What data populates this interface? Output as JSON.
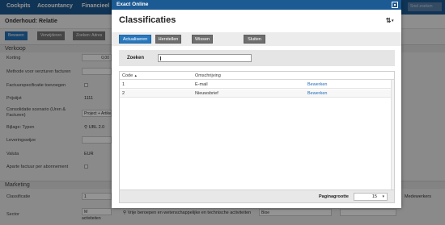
{
  "app": {
    "nav": [
      "Cockpits",
      "Accountancy",
      "Financieel"
    ],
    "search_placeholder": "Snel zoeken"
  },
  "background": {
    "title": "Onderhoud: Relatie",
    "toolbar": [
      "Bewaren",
      "Verwijderen",
      "Zoeken: Adres"
    ],
    "section_verkoop": "Verkoop",
    "rows": [
      {
        "label": "Korting",
        "value": "0,00"
      },
      {
        "label": "Methode voor verzturen facturen",
        "value": ""
      },
      {
        "label": "Factuurspecificatie toevoegen",
        "value": ""
      },
      {
        "label": "Prijsiijst",
        "value": "1111"
      },
      {
        "label": "Consolidatie scenario (Uren & Facturen)",
        "value": "Project + Artikel"
      },
      {
        "label": "Bijlage: Typen",
        "value": "UBL 2.0"
      },
      {
        "label": "Leveringswijze",
        "value": ""
      },
      {
        "label": "Valuta",
        "value": "EUR"
      },
      {
        "label": "Aparte factuur per abonnement",
        "value": ""
      }
    ],
    "section_marketing": "Marketing",
    "marketing_rows": [
      {
        "label": "Classificatie",
        "value": "1"
      },
      {
        "label": "Sector",
        "value": "M"
      }
    ],
    "sector_text": "Vrije beroepen en wetenschappelijke en technische activiteiten",
    "branche_value": "Bioe",
    "medewerkers": "Medewerkers"
  },
  "modal": {
    "window_title": "Exact Online",
    "heading": "Classificaties",
    "sort_icon": "sort-icon",
    "buttons": {
      "refresh": "Actualiseren",
      "restore": "Herstellen",
      "delete": "Wissen",
      "close": "Sluiten"
    },
    "search": {
      "label": "Zoeken",
      "value": ""
    },
    "columns": {
      "code": "Code",
      "code_sort": "▲",
      "description": "Omschrijving"
    },
    "rows": [
      {
        "code": "1",
        "description": "E-mail",
        "action": "Bewerken"
      },
      {
        "code": "2",
        "description": "Nieuwsbrief",
        "action": "Bewerken"
      }
    ],
    "footer": {
      "pagesize_label": "Paginagrootte",
      "pagesize_value": "15"
    }
  }
}
